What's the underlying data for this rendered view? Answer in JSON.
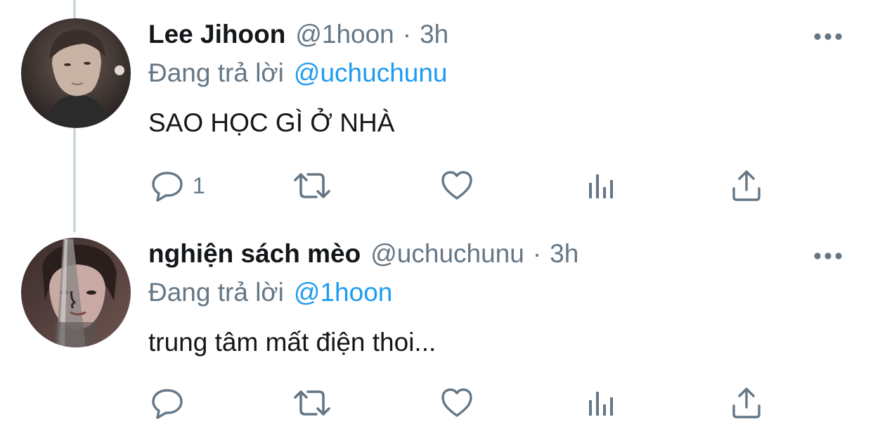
{
  "tweets": [
    {
      "name": "Lee Jihoon",
      "handle": "@1hoon",
      "separator": "·",
      "time": "3h",
      "reply_prefix": "Đang trả lời",
      "reply_to": "@uchuchunu",
      "text": "SAO HỌC GÌ Ở NHÀ",
      "reply_count": "1",
      "icons": [
        "more-icon",
        "reply-icon",
        "retweet-icon",
        "like-icon",
        "analytics-icon",
        "share-icon"
      ]
    },
    {
      "name": "nghiện sách mèo",
      "handle": "@uchuchunu",
      "separator": "·",
      "time": "3h",
      "reply_prefix": "Đang trả lời",
      "reply_to": "@1hoon",
      "text": "trung tâm mất điện thoi...",
      "reply_count": "",
      "icons": [
        "more-icon",
        "reply-icon",
        "retweet-icon",
        "like-icon",
        "analytics-icon",
        "share-icon"
      ]
    }
  ],
  "colors": {
    "text_primary": "#14171a",
    "text_secondary": "#657786",
    "link": "#1d9bf0",
    "thread_line": "#cfd9de"
  }
}
